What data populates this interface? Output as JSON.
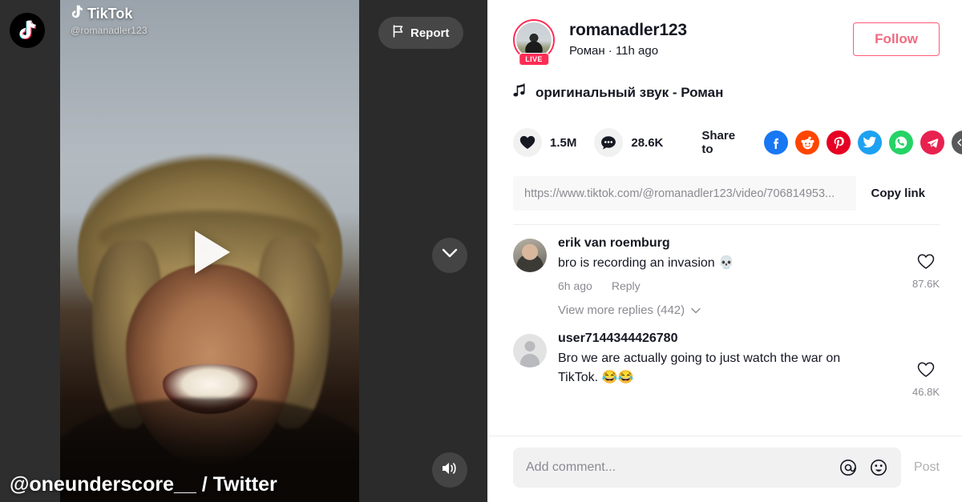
{
  "video_stage": {
    "watermark_brand": "TikTok",
    "watermark_handle": "@romanadler123",
    "report_label": "Report",
    "logo_icon": "tiktok-logo-icon",
    "play_icon": "play-icon",
    "chevron_icon": "chevron-down-icon",
    "volume_icon": "volume-on-icon",
    "credit": "@oneunderscore__ / Twitter"
  },
  "panel": {
    "author": {
      "username": "romanadler123",
      "subtitle": "Роман · 11h ago",
      "live_badge": "LIVE",
      "follow_label": "Follow"
    },
    "music": {
      "icon": "music-note-icon",
      "label": "оригинальный звук - Роман"
    },
    "engagement": {
      "like_icon": "heart-filled-icon",
      "like_count": "1.5M",
      "comment_icon": "comment-bubble-icon",
      "comment_count": "28.6K",
      "share_label": "Share to",
      "share_targets": [
        {
          "name": "facebook-share-icon",
          "glyph": "f",
          "color": "#1877f2"
        },
        {
          "name": "reddit-share-icon",
          "glyph": "",
          "color": "#ff4500"
        },
        {
          "name": "pinterest-share-icon",
          "glyph": "",
          "color": "#e60023"
        },
        {
          "name": "twitter-share-icon",
          "glyph": "",
          "color": "#1da1f2"
        },
        {
          "name": "whatsapp-share-icon",
          "glyph": "",
          "color": "#25d366"
        },
        {
          "name": "telegram-share-icon",
          "glyph": "",
          "color": "#e8224f"
        },
        {
          "name": "embed-share-icon",
          "glyph": "</>",
          "color": "#58595b"
        }
      ]
    },
    "link": {
      "url": "https://www.tiktok.com/@romanadler123/video/706814953...",
      "copy_label": "Copy link"
    },
    "comments": [
      {
        "avatar": "photo",
        "name": "erik van roemburg",
        "text": "bro is recording an invasion 💀",
        "time": "6h ago",
        "reply_label": "Reply",
        "like_icon": "heart-outline-icon",
        "like_count": "87.6K",
        "more_replies": "View more replies (442)"
      },
      {
        "avatar": "default",
        "name": "user7144344426780",
        "text": "Bro we are actually going to just watch the war on TikTok. 😂😂",
        "time": "",
        "reply_label": "",
        "like_icon": "heart-outline-icon",
        "like_count": "46.8K",
        "more_replies": ""
      }
    ],
    "composer": {
      "placeholder": "Add comment...",
      "value": "",
      "mention_icon": "at-mention-icon",
      "emoji_icon": "emoji-smile-icon",
      "post_label": "Post"
    }
  },
  "colors": {
    "brand_red": "#fe2c55",
    "follow_border": "#fe5a75",
    "text_primary": "#161823",
    "text_muted": "#8a8b91"
  }
}
